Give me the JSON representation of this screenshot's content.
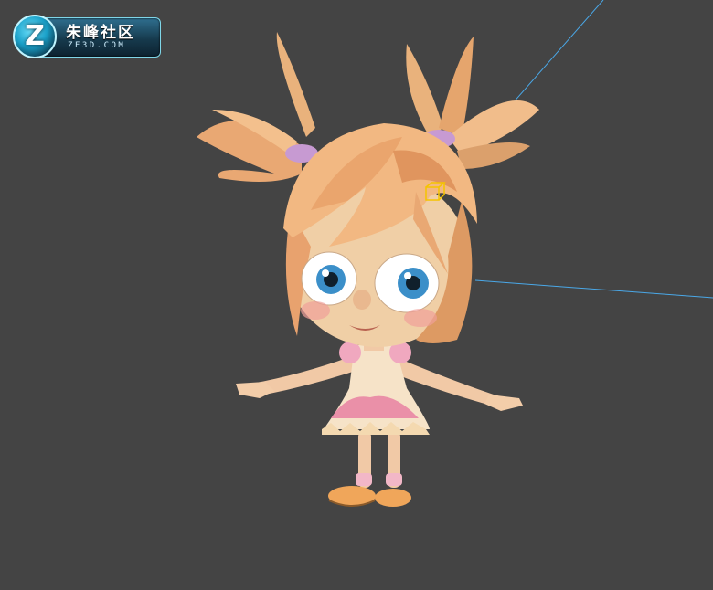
{
  "watermark": {
    "logo_letter": "Z",
    "title": "朱峰社区",
    "subtitle": "ZF3D.COM"
  },
  "viewport": {
    "background": "#444444",
    "light_line_color": "#4aa8e8",
    "light_icon_color": "#f5c400"
  },
  "model": {
    "skin": "#f3cda9",
    "hair_light": "#f6c99b",
    "hair_dark": "#c9844e",
    "dress": "#f6e3c8",
    "dress_pattern": "#e77aa0",
    "shoe": "#f0a65a",
    "sock": "#f2b7c7",
    "eye_iris": "#3b8fc9"
  }
}
